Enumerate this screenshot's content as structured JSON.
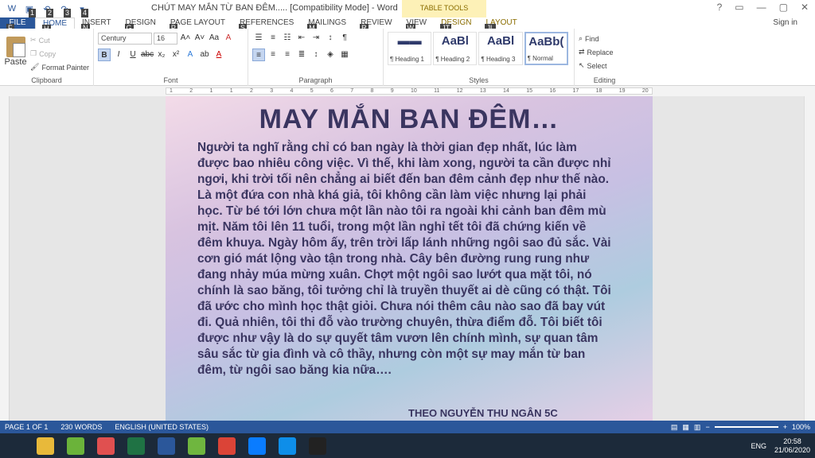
{
  "window": {
    "title": "CHÚT MAY MẮN TỪ BAN ĐÊM..... [Compatibility Mode] - Word",
    "context_tab_group": "TABLE TOOLS",
    "controls": [
      "?",
      "▭",
      "—",
      "▢",
      "✕"
    ]
  },
  "qat": {
    "keytips": [
      "1",
      "2",
      "3",
      "4"
    ]
  },
  "tabs": [
    {
      "label": "FILE",
      "keytip": "F"
    },
    {
      "label": "HOME",
      "keytip": "H"
    },
    {
      "label": "INSERT",
      "keytip": "N"
    },
    {
      "label": "DESIGN",
      "keytip": "G"
    },
    {
      "label": "PAGE LAYOUT",
      "keytip": "P"
    },
    {
      "label": "REFERENCES",
      "keytip": "S"
    },
    {
      "label": "MAILINGS",
      "keytip": "M"
    },
    {
      "label": "REVIEW",
      "keytip": "R"
    },
    {
      "label": "VIEW",
      "keytip": "W"
    },
    {
      "label": "DESIGN",
      "keytip": "JT"
    },
    {
      "label": "LAYOUT",
      "keytip": "JL"
    }
  ],
  "signin": "Sign in",
  "clipboard": {
    "paste": "Paste",
    "cut": "Cut",
    "copy": "Copy",
    "format_painter": "Format Painter",
    "label": "Clipboard"
  },
  "font": {
    "name": "Century Gothic",
    "size": "16",
    "label": "Font"
  },
  "paragraph": {
    "label": "Paragraph"
  },
  "styles": {
    "items": [
      {
        "sample": "▬▬",
        "name": "¶ Heading 1"
      },
      {
        "sample": "AaBl",
        "name": "¶ Heading 2"
      },
      {
        "sample": "AaBl",
        "name": "¶ Heading 3"
      },
      {
        "sample": "AaBb(",
        "name": "¶ Normal"
      }
    ],
    "label": "Styles"
  },
  "editing": {
    "find": "Find",
    "replace": "Replace",
    "select": "Select",
    "label": "Editing"
  },
  "ruler": {
    "ticks": [
      "1",
      "2",
      "1",
      "1",
      "2",
      "3",
      "4",
      "5",
      "6",
      "7",
      "8",
      "9",
      "10",
      "11",
      "12",
      "13",
      "14",
      "15",
      "16",
      "17",
      "18",
      "19",
      "20"
    ]
  },
  "document": {
    "title": "MAY MẮN BAN ĐÊM…",
    "body": "Người ta nghĩ rằng chỉ có ban ngày là thời gian đẹp nhất, lúc làm được bao nhiêu công việc. Vì thế, khi làm xong, người ta cần được nhỉ ngơi, khi trời tối nên chẳng ai biết đến ban đêm cảnh đẹp như thế nào. Là một đứa con nhà khá giả, tôi không cần làm việc nhưng lại phải học. Từ bé tới lớn chưa một lần nào tôi ra ngoài khi cảnh ban đêm mù mịt. Năm tôi lên 11 tuổi, trong một lần nghỉ tết tôi đã chứng kiến về đêm khuya. Ngày hôm ấy, trên trời lấp lánh những ngôi sao đủ sắc. Vài cơn gió mát lộng vào tận trong nhà. Cây bên đường rung rung như đang nhảy múa mừng xuân. Chợt một ngôi sao lướt qua mặt tôi, nó chính là sao băng, tôi tưởng chỉ là truyền thuyết ai dè cũng có thật. Tôi đã ước cho mình học thật giỏi. Chưa nói thêm câu nào sao đã bay vút đi. Quả nhiên, tôi thi đỗ vào trường chuyên, thừa điểm đỗ. Tôi biết tôi được như vậy là do sự quyết tâm vươn lên chính mình, sự quan tâm sâu sắc từ gia đình và cô thầy, nhưng còn một sự may mắn từ ban đêm, từ ngôi sao băng kia nữa….",
    "signature": "THEO NGUYỄN THU NGÂN 5C"
  },
  "status": {
    "page": "PAGE 1 OF 1",
    "words": "230 WORDS",
    "language": "ENGLISH (UNITED STATES)",
    "zoom": "100%"
  },
  "taskbar": {
    "apps": [
      {
        "name": "windows-start",
        "color": "#1c2a3a"
      },
      {
        "name": "file-explorer",
        "color": "#e8b93a"
      },
      {
        "name": "bluestacks",
        "color": "#6bb33a"
      },
      {
        "name": "unknown-app",
        "color": "#e05050"
      },
      {
        "name": "excel",
        "color": "#1f7244"
      },
      {
        "name": "word",
        "color": "#2b579a"
      },
      {
        "name": "coccoc",
        "color": "#6fb63f"
      },
      {
        "name": "chrome",
        "color": "#db4437"
      },
      {
        "name": "zalo",
        "color": "#0a7cff"
      },
      {
        "name": "teamviewer",
        "color": "#0e8ee9"
      },
      {
        "name": "camera",
        "color": "#222222"
      }
    ],
    "tray_lang": "ENG",
    "time": "20:58",
    "date": "21/06/2020"
  },
  "colors": {
    "word_blue": "#2b579a",
    "doc_text": "#3a3560",
    "context_tab": "#fdf1b7"
  }
}
